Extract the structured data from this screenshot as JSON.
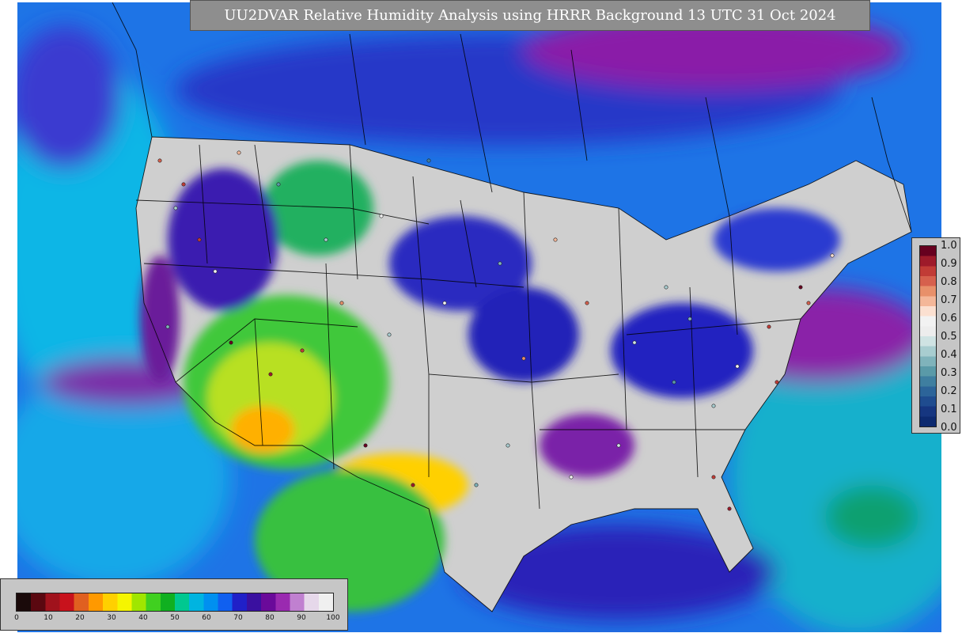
{
  "title": "UU2DVAR Relative Humidity Analysis using HRRR Background 13 UTC 31 Oct 2024",
  "obs_colorbar": {
    "ticks": [
      "1.0",
      "0.9",
      "0.8",
      "0.7",
      "0.6",
      "0.5",
      "0.4",
      "0.3",
      "0.2",
      "0.1",
      "0.0"
    ],
    "colors_top_to_bottom": [
      "#67001f",
      "#9e1a2a",
      "#c13b36",
      "#d6604d",
      "#e8906a",
      "#f4b799",
      "#fbe0d1",
      "#f2f2f2",
      "#ededed",
      "#cfe3e3",
      "#a8cdd0",
      "#7fb3bb",
      "#5a9aa8",
      "#3f7fa0",
      "#2c6499",
      "#1f4c8f",
      "#163680",
      "#0d2a70"
    ]
  },
  "rh_colorbar": {
    "ticks": [
      "0",
      "10",
      "20",
      "30",
      "40",
      "50",
      "60",
      "70",
      "80",
      "90",
      "100"
    ],
    "colors": [
      "#1a0a0a",
      "#5a0810",
      "#a0121c",
      "#c8121c",
      "#e06020",
      "#ff9900",
      "#ffd000",
      "#f5f500",
      "#a0e600",
      "#40d020",
      "#10b020",
      "#00c890",
      "#00b4e0",
      "#0090f0",
      "#1060f0",
      "#2020c8",
      "#3a10a0",
      "#6a0a9a",
      "#9a2ab0",
      "#c080d0",
      "#e6d8ea",
      "#f0f0f0"
    ]
  }
}
